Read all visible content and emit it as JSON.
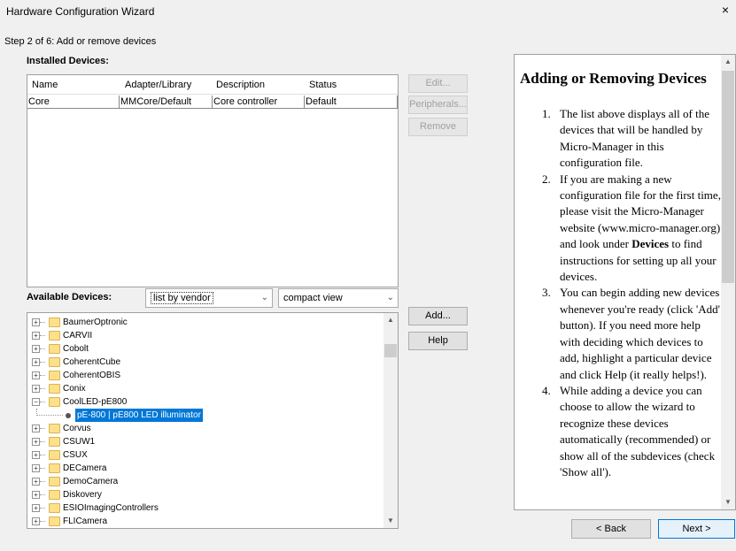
{
  "window": {
    "title": "Hardware Configuration Wizard",
    "close_glyph": "×"
  },
  "step_label": "Step 2 of 6: Add or remove devices",
  "installed": {
    "label": "Installed Devices:",
    "columns": [
      "Name",
      "Adapter/Library",
      "Description",
      "Status"
    ],
    "rows": [
      [
        "Core",
        "MMCore/Default",
        "Core controller",
        "Default"
      ]
    ],
    "buttons": {
      "edit": "Edit...",
      "peripherals": "Peripherals...",
      "remove": "Remove"
    }
  },
  "available": {
    "label": "Available Devices:",
    "view_by": "list by vendor",
    "view_mode": "compact view",
    "buttons": {
      "add": "Add...",
      "help": "Help"
    },
    "tree": [
      {
        "label": "BaumerOptronic",
        "type": "folder"
      },
      {
        "label": "CARVII",
        "type": "folder"
      },
      {
        "label": "Cobolt",
        "type": "folder"
      },
      {
        "label": "CoherentCube",
        "type": "folder"
      },
      {
        "label": "CoherentOBIS",
        "type": "folder"
      },
      {
        "label": "Conix",
        "type": "folder"
      },
      {
        "label": "CoolLED-pE800",
        "type": "folder-open"
      },
      {
        "label": "pE-800 | pE800 LED illuminator",
        "type": "device-selected"
      },
      {
        "label": "Corvus",
        "type": "folder"
      },
      {
        "label": "CSUW1",
        "type": "folder"
      },
      {
        "label": "CSUX",
        "type": "folder"
      },
      {
        "label": "DECamera",
        "type": "folder"
      },
      {
        "label": "DemoCamera",
        "type": "folder"
      },
      {
        "label": "Diskovery",
        "type": "folder"
      },
      {
        "label": "ESIOImagingControllers",
        "type": "folder"
      },
      {
        "label": "FLICamera",
        "type": "folder"
      }
    ]
  },
  "help": {
    "title": "Adding or Removing Devices",
    "items": [
      {
        "num": "1.",
        "html_parts": [
          "The list above displays all of the devices that will be handled by Micro-Manager in this configuration file."
        ]
      },
      {
        "num": "2.",
        "html_parts": [
          "If you are making a new configuration file for the first time, please visit the Micro-Manager website (www.micro-manager.org) and look under ",
          "Devices",
          " to find instructions for setting up all your devices."
        ]
      },
      {
        "num": "3.",
        "html_parts": [
          "You can begin adding new devices whenever you're ready (click 'Add' button). If you need more help with deciding which devices to add, highlight a particular device and click Help (it really helps!)."
        ]
      },
      {
        "num": "4.",
        "html_parts": [
          "While adding a device you can choose to allow the wizard to recognize these devices automatically (recommended) or show all of the subdevices (check 'Show all')."
        ]
      }
    ]
  },
  "nav": {
    "back": "< Back",
    "next": "Next >"
  }
}
